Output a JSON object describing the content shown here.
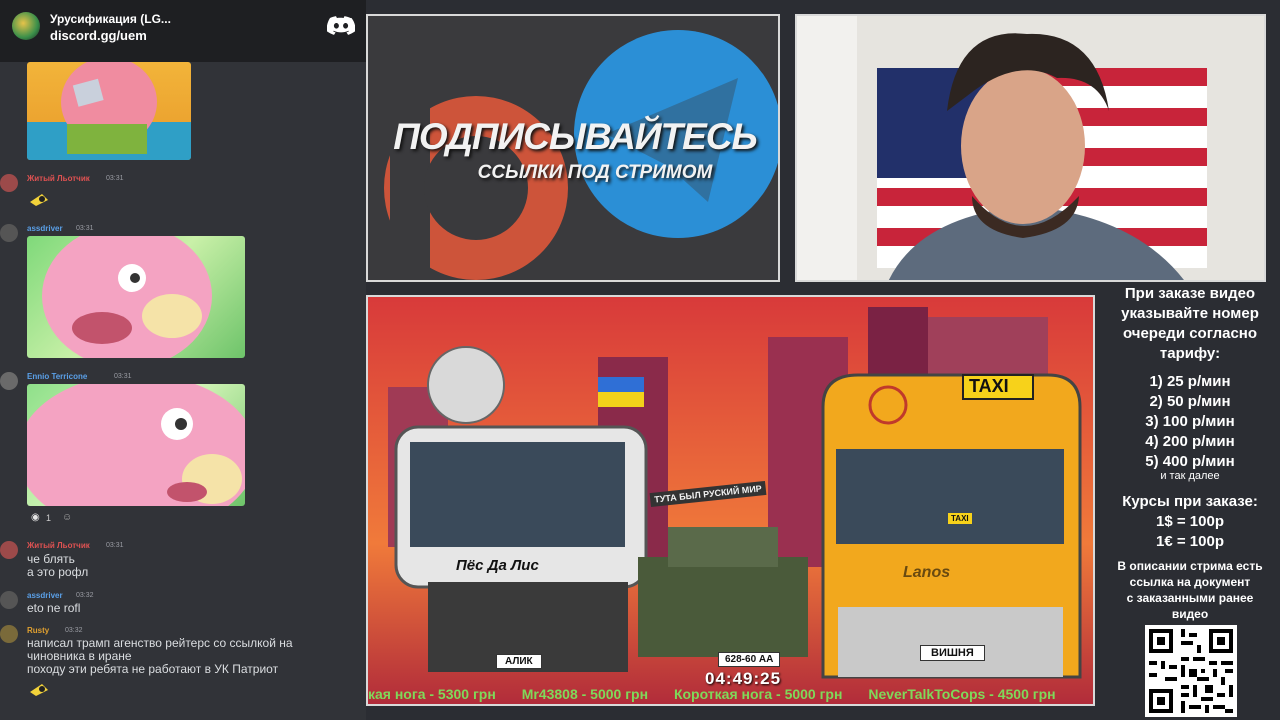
{
  "chat": {
    "server_name": "Урусификация (LG...",
    "server_invite": "discord.gg/uem",
    "messages": [
      {
        "user": "Житый Льотчик",
        "time": "03:31",
        "user_color": "#e05252"
      },
      {
        "user": "assdriver",
        "time": "03:31",
        "user_color": "#5aa0e8"
      },
      {
        "user": "Ennio Terricone",
        "time": "03:31",
        "user_color": "#5aa0e8"
      },
      {
        "user": "Житый Льотчик",
        "time": "03:31",
        "user_color": "#e05252",
        "lines": [
          "че блять",
          "а это рофл"
        ]
      },
      {
        "user": "assdriver",
        "time": "03:32",
        "user_color": "#5aa0e8",
        "lines": [
          "eto ne rofl"
        ]
      },
      {
        "user": "Rusty",
        "time": "03:32",
        "user_color": "#e0a030",
        "lines": [
          "написал трамп агенство рейтерс со ссылкой на",
          "чиновника в иране",
          "походу эти ребята не работают в УК Патриот"
        ]
      }
    ],
    "reaction_count": "1"
  },
  "promo": {
    "title": "ПОДПИСЫВАЙТЕСЬ",
    "subtitle": "ССЫЛКИ ПОД СТРИМОМ"
  },
  "info": {
    "intro": [
      "При заказе видео",
      "указывайте номер",
      "очереди согласно",
      "тарифу:"
    ],
    "tariffs": [
      "1) 25 р/мин",
      "2) 50 р/мин",
      "3) 100 р/мин",
      "4) 200 р/мин",
      "5) 400 р/мин"
    ],
    "tariff_more": "и так далее",
    "rates": [
      "Курсы при заказе:",
      "1$ = 100р",
      "1€ = 100р"
    ],
    "desc_note": [
      "В описании стрима есть",
      "ссылка на документ",
      "с заказанными ранее",
      "видео"
    ]
  },
  "video": {
    "timer": "04:49:25",
    "taxi_sign": "TAXI",
    "van_banner": "Пёс Да Лис",
    "tank_banner": "ТУТА БЫЛ РУСКИЙ МИР",
    "plate_left": "АЛИК",
    "plate_tank": "628-60 АА",
    "plate_right": "ВИШНЯ",
    "van_logo": "Lanos",
    "taxi_mini": "TAXI",
    "ticker": [
      "кая нога - 5300 грн",
      "Mr43808 - 5000 грн",
      "Короткая нога - 5000 грн",
      "NeverTalkToCops - 4500 грн"
    ]
  },
  "colors": {
    "chat_bg": "#313338",
    "header_bg": "#1e1f22",
    "ticker": "#7fd95a",
    "taxi_yellow": "#f2a81d"
  }
}
